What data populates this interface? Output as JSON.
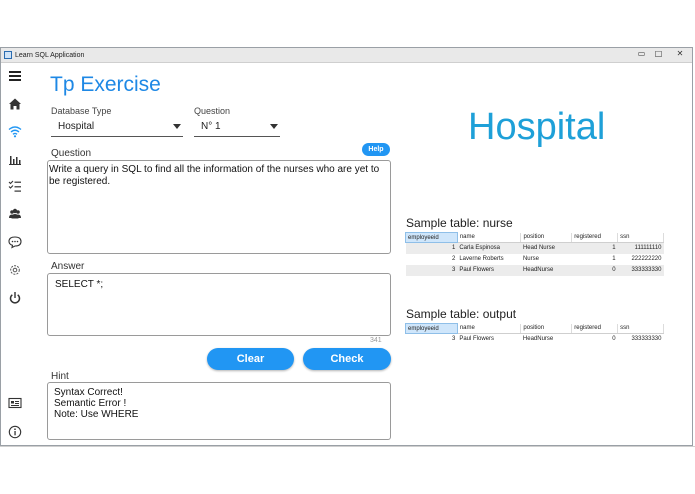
{
  "window": {
    "title": "Learn SQL Application",
    "minimize": "▭",
    "maximize": "□",
    "close": "✕"
  },
  "sidebar": {
    "items": [
      {
        "name": "menu-icon"
      },
      {
        "name": "home-icon"
      },
      {
        "name": "wifi-icon",
        "active": true
      },
      {
        "name": "bar-chart-icon"
      },
      {
        "name": "checklist-icon"
      },
      {
        "name": "users-icon"
      },
      {
        "name": "chat-icon"
      },
      {
        "name": "settings-icon"
      },
      {
        "name": "power-icon"
      },
      {
        "name": "card-icon"
      },
      {
        "name": "info-icon"
      }
    ]
  },
  "main": {
    "title": "Tp Exercise",
    "database_type": {
      "label": "Database Type",
      "value": "Hospital"
    },
    "question_select": {
      "label": "Question",
      "value": "N° 1"
    },
    "question": {
      "label": "Question",
      "help_label": "Help",
      "text": "Write a query in SQL to find all the information of the nurses who are yet to be registered."
    },
    "answer": {
      "label": "Answer",
      "text": "SELECT *;",
      "counter": "341"
    },
    "buttons": {
      "clear": "Clear",
      "check": "Check"
    },
    "hint": {
      "label": "Hint",
      "lines": [
        "Syntax Correct!",
        "Semantic Error !",
        "Note: Use WHERE"
      ]
    }
  },
  "right": {
    "database_title": "Hospital",
    "nurse_table": {
      "title": "Sample table: nurse",
      "columns": [
        "employeeid",
        "name",
        "position",
        "registered",
        "ssn"
      ],
      "rows": [
        [
          "1",
          "Carla Espinosa",
          "Head Nurse",
          "1",
          "111111110"
        ],
        [
          "2",
          "Laverne Roberts",
          "Nurse",
          "1",
          "222222220"
        ],
        [
          "3",
          "Paul Flowers",
          "HeadNurse",
          "0",
          "333333330"
        ]
      ]
    },
    "output_table": {
      "title": "Sample table: output",
      "columns": [
        "employeeid",
        "name",
        "position",
        "registered",
        "ssn"
      ],
      "rows": [
        [
          "3",
          "Paul Flowers",
          "HeadNurse",
          "0",
          "333333330"
        ]
      ]
    }
  },
  "colors": {
    "accent": "#2196f3",
    "title_blue": "#1e88e5",
    "big_title_blue": "#1ea0d8"
  }
}
